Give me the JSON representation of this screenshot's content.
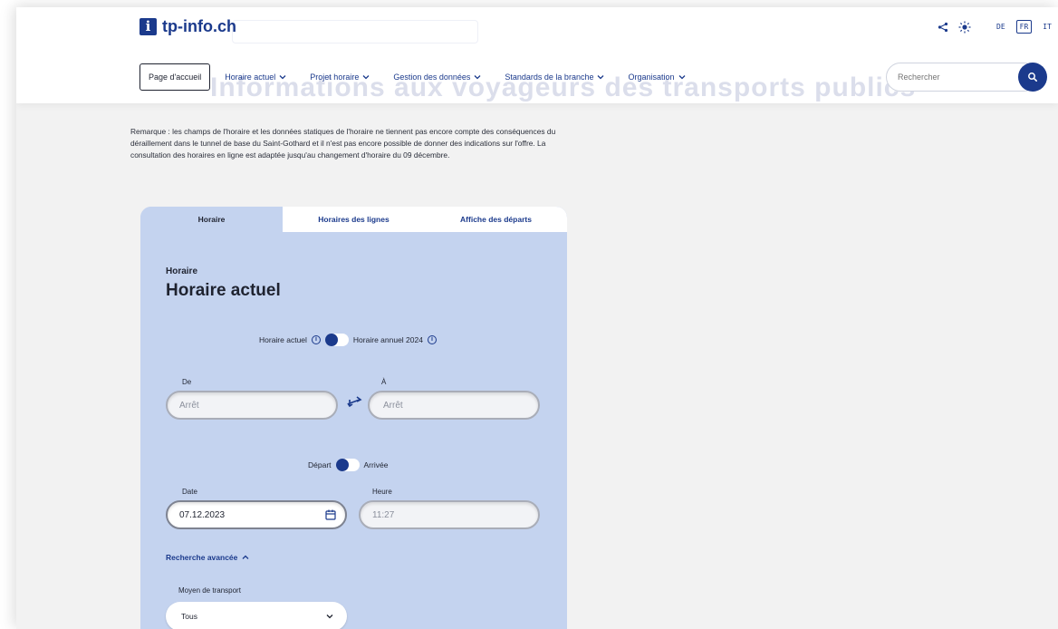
{
  "header": {
    "logo_glyph": "i",
    "logo_text": "tp-info.ch",
    "ghost_title": "Informations aux voyageurs des transports publics",
    "icons": {
      "share": "share-icon",
      "theme": "sun-icon"
    },
    "languages": [
      "DE",
      "FR",
      "IT"
    ],
    "active_language": "FR"
  },
  "nav": {
    "home": "Page d'accueil",
    "items": [
      "Horaire actuel",
      "Projet horaire",
      "Gestion des données",
      "Standards de la branche",
      "Organisation"
    ]
  },
  "search": {
    "placeholder": "Rechercher",
    "icon": "search-icon"
  },
  "remark": "Remarque : les champs de l'horaire et les données statiques de l'horaire ne tiennent pas encore compte des conséquences du déraillement dans le tunnel de base du Saint-Gothard et il n'est pas encore possible de donner des indications sur l'offre. La consultation des horaires en ligne est adaptée jusqu'au changement d'horaire du 09 décembre.",
  "tabs": [
    "Horaire",
    "Horaires des lignes",
    "Affiche des départs"
  ],
  "active_tab": 0,
  "card": {
    "subtitle": "Horaire",
    "title": "Horaire actuel",
    "timetable_toggle": {
      "left": "Horaire actuel",
      "right": "Horaire annuel 2024"
    },
    "from_label": "De",
    "from_placeholder": "Arrêt",
    "to_label": "À",
    "to_placeholder": "Arrêt",
    "direction_toggle": {
      "left": "Départ",
      "right": "Arrivée"
    },
    "date_label": "Date",
    "date_value": "07.12.2023",
    "time_label": "Heure",
    "time_value": "11:27",
    "advanced_label": "Recherche avancée",
    "transport_label": "Moyen de transport",
    "transport_value": "Tous"
  },
  "colors": {
    "brand": "#1b3a8c",
    "card_bg": "#c4d3ef",
    "page_bg": "#f2f2f2"
  }
}
